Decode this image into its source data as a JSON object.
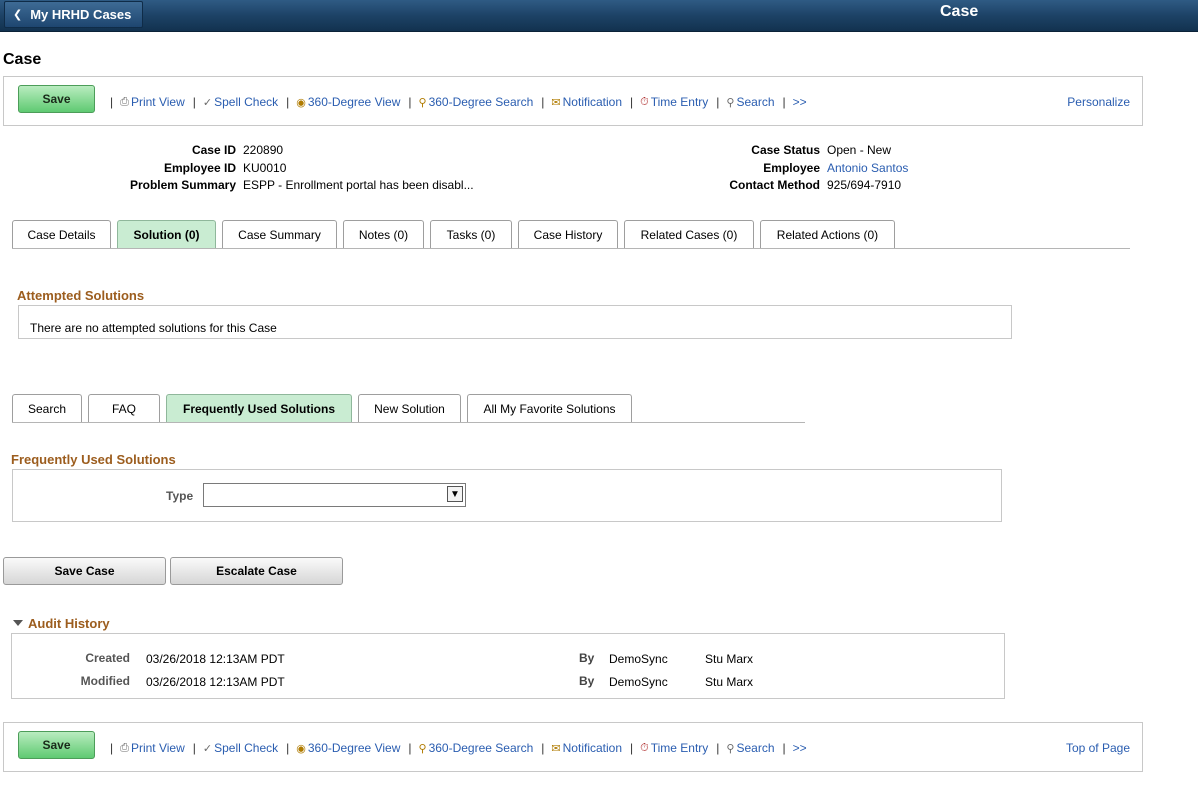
{
  "header": {
    "back_label": "My HRHD Cases",
    "title": "Case"
  },
  "page_title": "Case",
  "toolbar": {
    "save_label": "Save",
    "items": [
      {
        "label": "Print View",
        "icon": "printer-icon"
      },
      {
        "label": "Spell Check",
        "icon": "spell-check-icon"
      },
      {
        "label": "360-Degree View",
        "icon": "360-view-icon"
      },
      {
        "label": "360-Degree Search",
        "icon": "360-search-icon"
      },
      {
        "label": "Notification",
        "icon": "notification-icon"
      },
      {
        "label": "Time Entry",
        "icon": "stopwatch-icon"
      },
      {
        "label": "Search",
        "icon": "search-icon"
      },
      {
        "label": ">>",
        "icon": ""
      }
    ],
    "personalize": "Personalize",
    "top_of_page": "Top of Page"
  },
  "case": {
    "case_id_label": "Case ID",
    "case_id": "220890",
    "employee_id_label": "Employee ID",
    "employee_id": "KU0010",
    "problem_summary_label": "Problem Summary",
    "problem_summary": "ESPP - Enrollment portal has been disabl...",
    "case_status_label": "Case Status",
    "case_status": "Open - New",
    "employee_label": "Employee",
    "employee": "Antonio Santos",
    "contact_method_label": "Contact Method",
    "contact_method": "925/694-7910"
  },
  "main_tabs": [
    {
      "label": "Case Details",
      "active": false
    },
    {
      "label": "Solution (0)",
      "active": true
    },
    {
      "label": "Case Summary",
      "active": false
    },
    {
      "label": "Notes (0)",
      "active": false
    },
    {
      "label": "Tasks (0)",
      "active": false
    },
    {
      "label": "Case History",
      "active": false
    },
    {
      "label": "Related Cases (0)",
      "active": false
    },
    {
      "label": "Related Actions (0)",
      "active": false
    }
  ],
  "attempted": {
    "title": "Attempted Solutions",
    "empty_message": "There are no attempted solutions for this Case"
  },
  "solution_tabs": [
    {
      "label": "Search",
      "active": false
    },
    {
      "label": "FAQ",
      "active": false
    },
    {
      "label": "Frequently Used Solutions",
      "active": true
    },
    {
      "label": "New Solution",
      "active": false
    },
    {
      "label": "All My Favorite Solutions",
      "active": false
    }
  ],
  "frequent": {
    "title": "Frequently Used Solutions",
    "type_label": "Type",
    "type_value": ""
  },
  "actions": {
    "save_case": "Save Case",
    "escalate_case": "Escalate Case"
  },
  "audit": {
    "title": "Audit History",
    "rows": [
      {
        "label": "Created",
        "datetime": "03/26/2018 12:13AM PDT",
        "by_label": "By",
        "by_id": "DemoSync",
        "by_name": "Stu Marx"
      },
      {
        "label": "Modified",
        "datetime": "03/26/2018 12:13AM PDT",
        "by_label": "By",
        "by_id": "DemoSync",
        "by_name": "Stu Marx"
      }
    ]
  },
  "colors": {
    "header_blue": "#1d4266",
    "save_green": "#5fca72",
    "section_brown": "#9c5d1e",
    "link_blue": "#2a5db0",
    "active_tab": "#c9ecd2"
  }
}
